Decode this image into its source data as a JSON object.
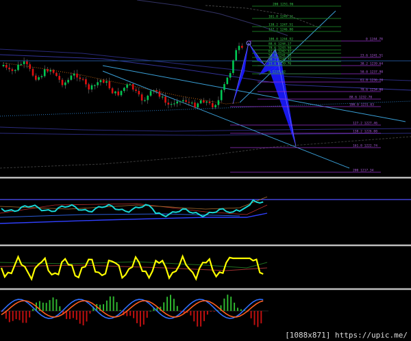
{
  "watermark": "[1088x871] https://upic.me/",
  "colors": {
    "background": "#000000",
    "separator": "#bfbfbf",
    "bull_candle": "#00c853",
    "bear_candle": "#e01010",
    "pattern_fill": "#1a1aff",
    "channel": "#3aa0d8",
    "fib_retrace": "#9b30d0",
    "fib_ext": "#1f9a2e",
    "osc_cyan": "#18d8d8",
    "osc_yellow": "#ffff00",
    "macd_hist_up": "#2fb52f",
    "macd_hist_down": "#c01010",
    "macd_line": "#3070ff",
    "signal_line": "#ff6020"
  },
  "fib_retrace_labels": [
    "0 1244.78",
    "23.6 1241.51",
    "38.2 1239.64",
    "50.0 1237.90",
    "61.8 1236.20",
    "78.6 1234.00",
    "88.6 1232.70",
    "100.0 1231.03",
    "127.2 1227.46",
    "138.2 1226.00",
    "161.8 1222.74",
    "200 1217.34"
  ],
  "fib_ext_labels": [
    "200 1251.96",
    "161.8 1249.11",
    "138.2 1247.51",
    "127.2 1246.80",
    "100.0 1244.92",
    "88.6 1244.17",
    "78.6 1243.50",
    "61.8 1242.32",
    "50.0 1241.53",
    "38.2 1240.74",
    "23.6 1239.76",
    "0 1237.62"
  ]
}
